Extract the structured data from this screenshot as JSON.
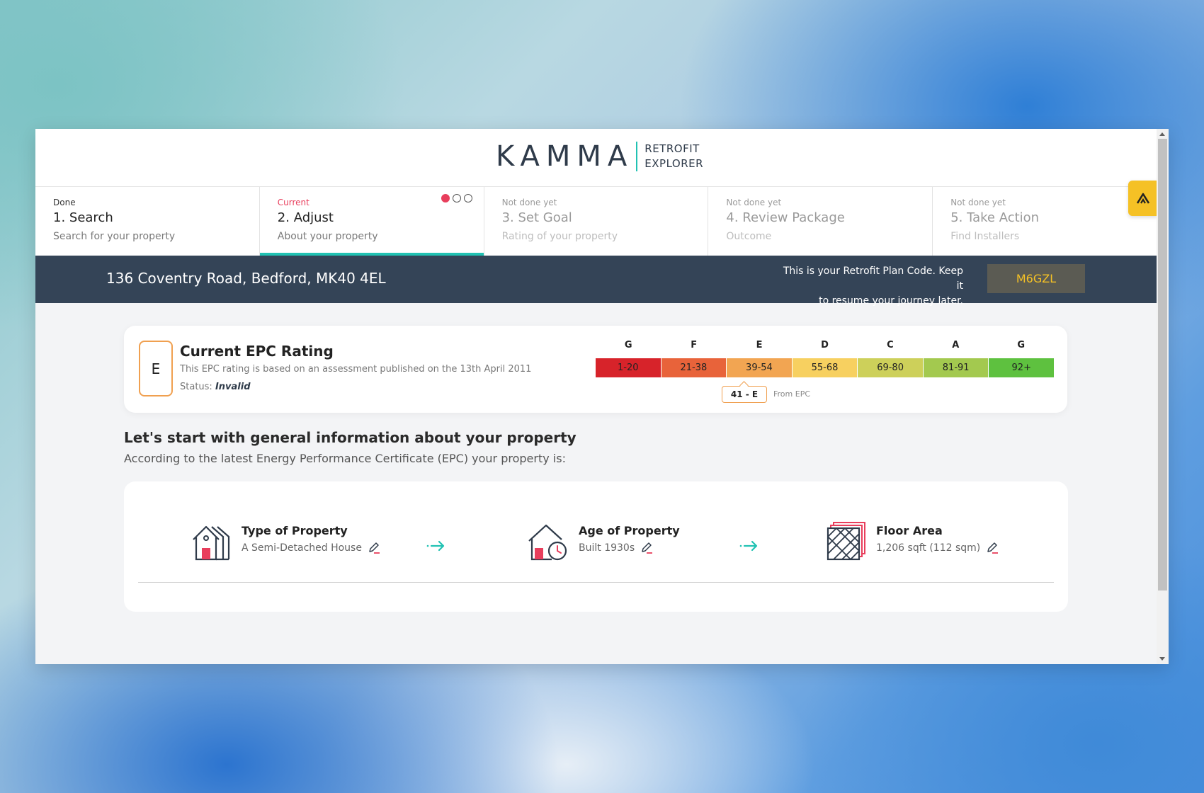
{
  "brand": {
    "wordmark": "KAMMA",
    "sub_line1": "RETROFIT",
    "sub_line2": "EXPLORER",
    "accent": "#21c2b3"
  },
  "steps": [
    {
      "status": "Done",
      "title": "1. Search",
      "subtitle": "Search for your property"
    },
    {
      "status": "Current",
      "title": "2. Adjust",
      "subtitle": "About your property"
    },
    {
      "status": "Not done yet",
      "title": "3. Set Goal",
      "subtitle": "Rating of your property"
    },
    {
      "status": "Not done yet",
      "title": "4. Review Package",
      "subtitle": "Outcome"
    },
    {
      "status": "Not done yet",
      "title": "5. Take Action",
      "subtitle": "Find Installers"
    }
  ],
  "progress_dots": {
    "total": 3,
    "active": 1
  },
  "address_bar": {
    "address": "136 Coventry Road, Bedford, MK40 4EL",
    "plan_text_line1": "This is your Retrofit Plan Code. Keep it",
    "plan_text_line2": "to resume your journey later.",
    "plan_code": "M6GZL"
  },
  "epc": {
    "letter": "E",
    "title": "Current EPC Rating",
    "description": "This EPC rating is based on an assessment published on the 13th April 2011",
    "status_label": "Status:",
    "status_value": "Invalid",
    "scale_letters": [
      "G",
      "F",
      "E",
      "D",
      "C",
      "A",
      "G"
    ],
    "scale_ranges": [
      "1-20",
      "21-38",
      "39-54",
      "55-68",
      "69-80",
      "81-91",
      "92+"
    ],
    "scale_colors": [
      "#d7232a",
      "#e8633a",
      "#f2a552",
      "#f7d060",
      "#cdd05a",
      "#a3c94f",
      "#5ec13f"
    ],
    "marker": "41 - E",
    "marker_note": "From EPC"
  },
  "intro": {
    "heading": "Let's start with general information about your property",
    "subheading": "According to the latest Energy Performance Certificate (EPC) your property is:"
  },
  "property": [
    {
      "label": "Type of Property",
      "value": "A Semi-Detached House",
      "icon": "semi-detached-house-icon"
    },
    {
      "label": "Age of Property",
      "value": "Built 1930s",
      "icon": "house-clock-icon"
    },
    {
      "label": "Floor Area",
      "value": "1,206 sqft (112 sqm)",
      "icon": "floor-tiles-icon"
    }
  ]
}
